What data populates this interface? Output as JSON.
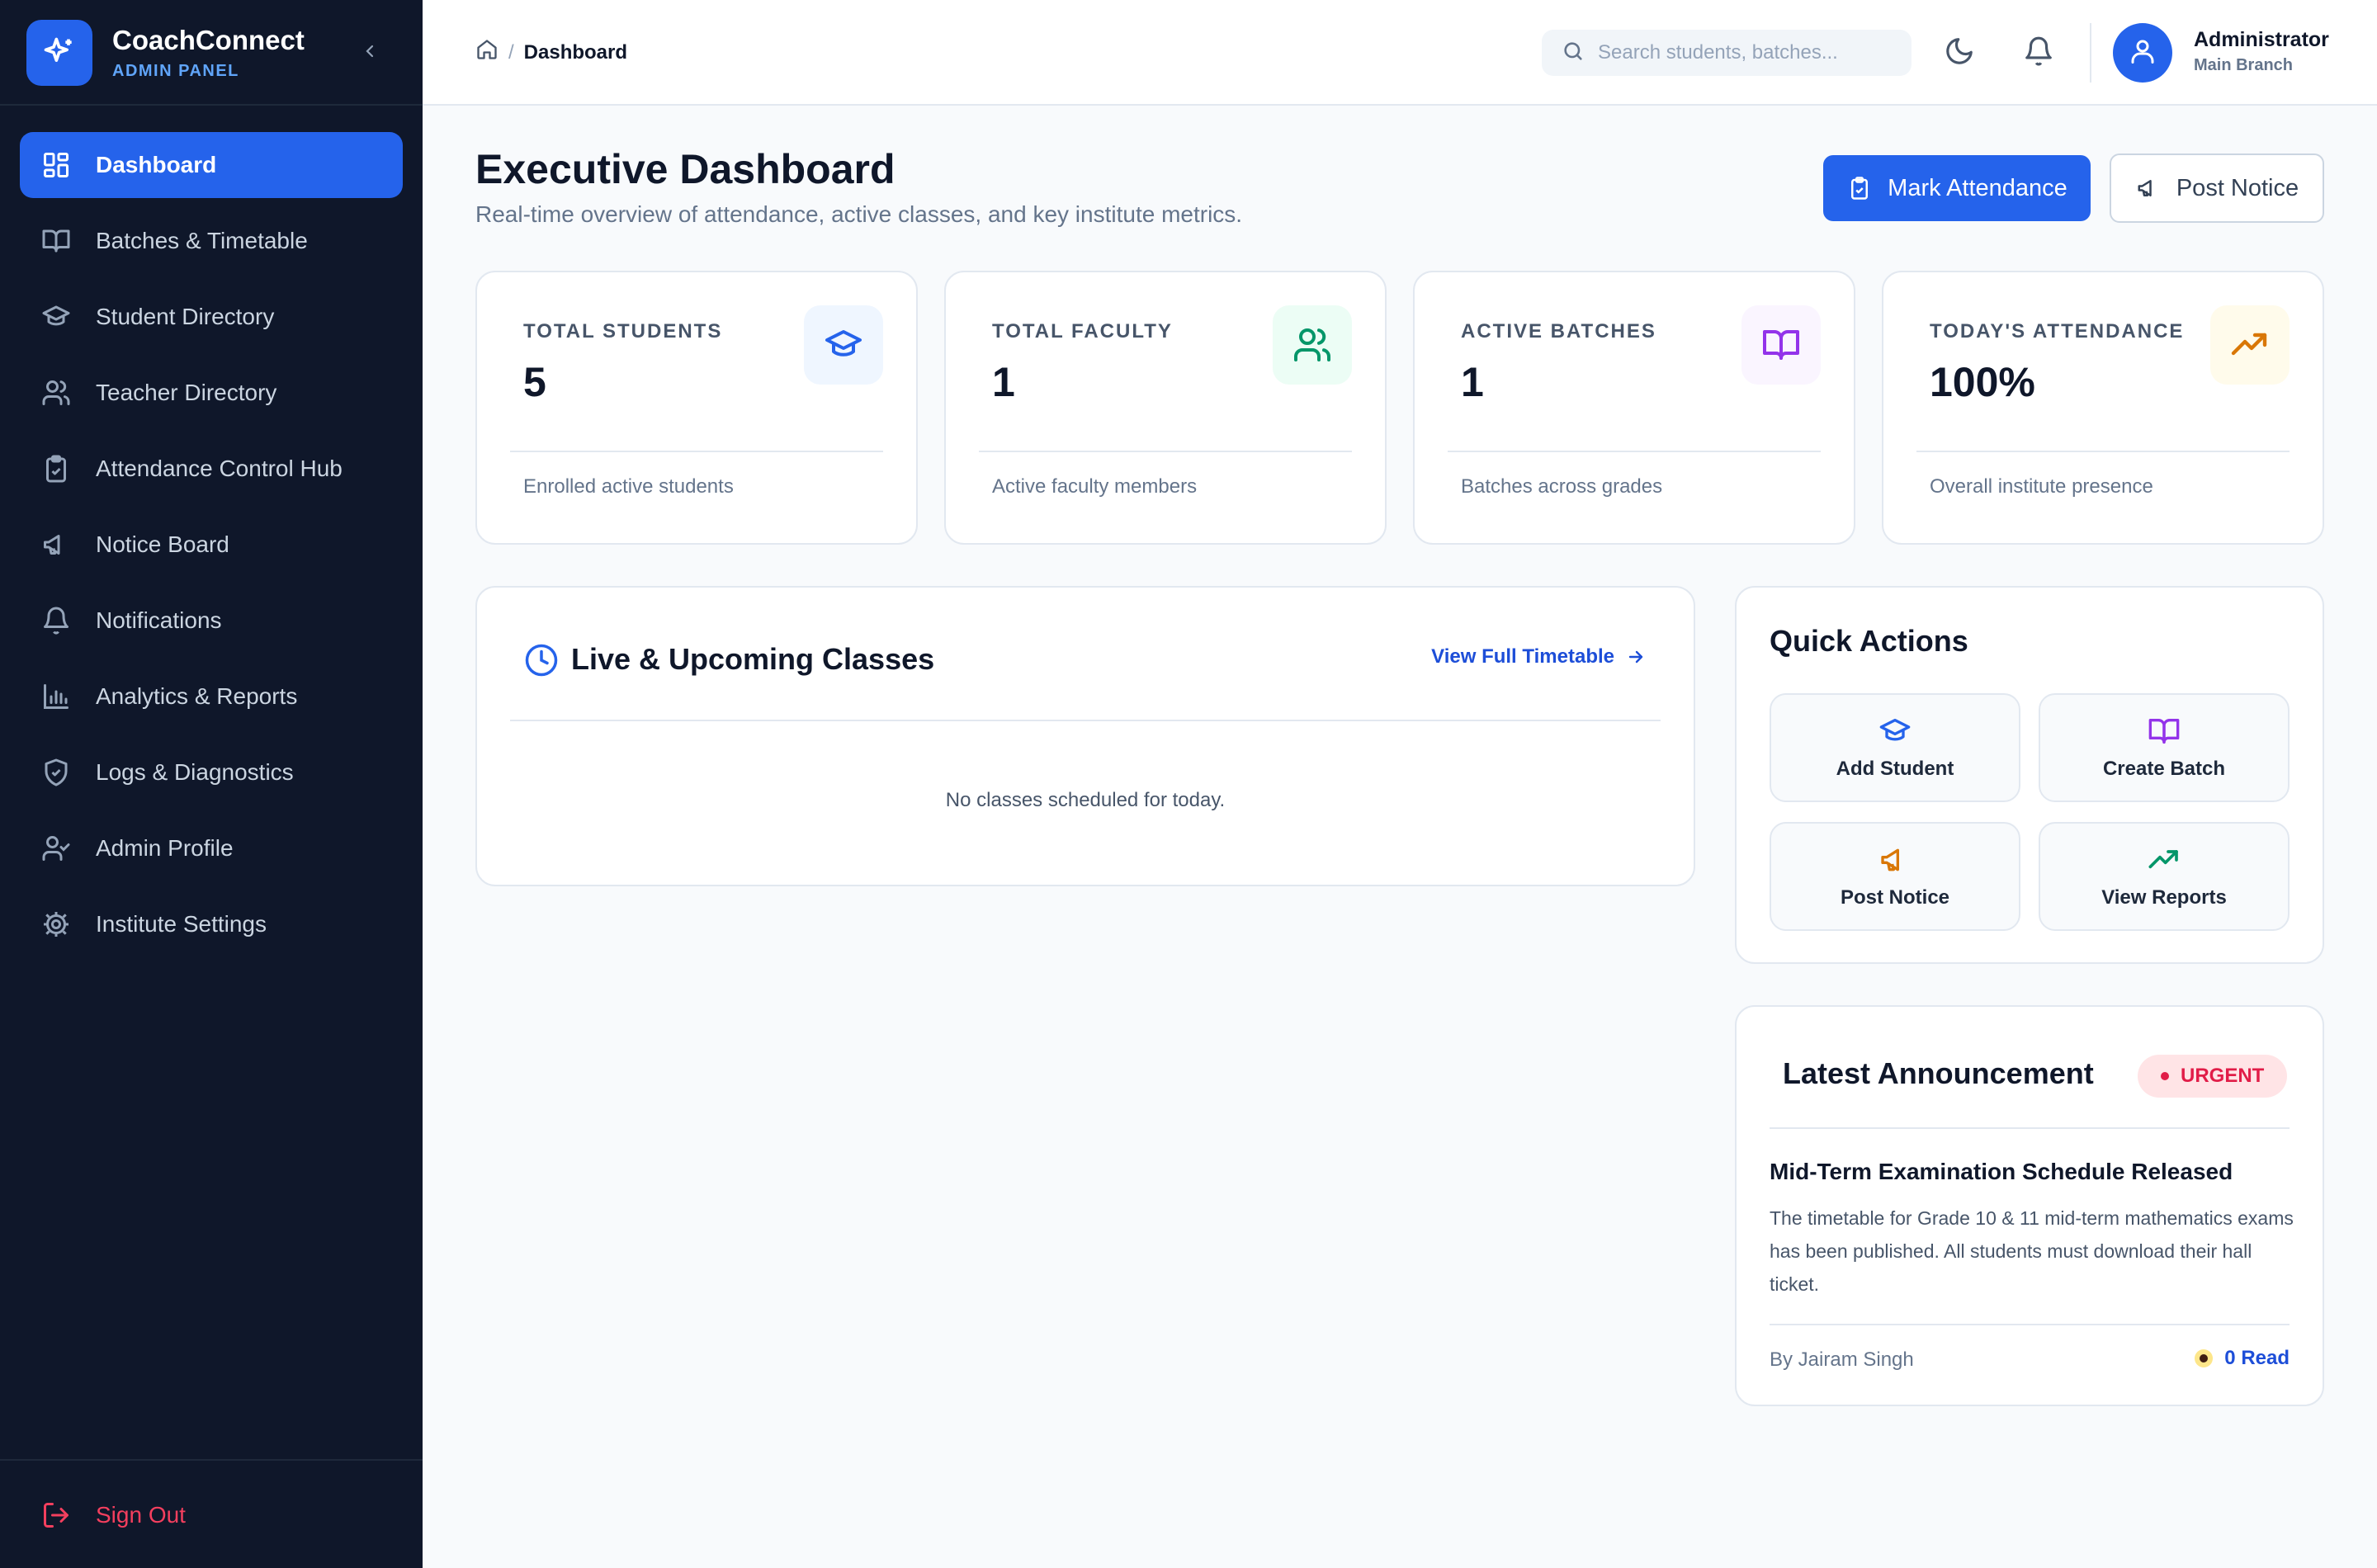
{
  "brand": {
    "name": "CoachConnect",
    "subtitle": "ADMIN PANEL"
  },
  "sidebar": {
    "items": [
      {
        "label": "Dashboard",
        "icon": "grid-icon",
        "active": true
      },
      {
        "label": "Batches & Timetable",
        "icon": "book-open-icon"
      },
      {
        "label": "Student Directory",
        "icon": "graduation-cap-icon"
      },
      {
        "label": "Teacher Directory",
        "icon": "users-icon"
      },
      {
        "label": "Attendance Control Hub",
        "icon": "clipboard-check-icon"
      },
      {
        "label": "Notice Board",
        "icon": "megaphone-icon"
      },
      {
        "label": "Notifications",
        "icon": "bell-icon"
      },
      {
        "label": "Analytics & Reports",
        "icon": "bar-chart-icon"
      },
      {
        "label": "Logs & Diagnostics",
        "icon": "shield-check-icon"
      },
      {
        "label": "Admin Profile",
        "icon": "user-check-icon"
      },
      {
        "label": "Institute Settings",
        "icon": "gear-icon"
      }
    ],
    "signout": "Sign Out"
  },
  "header": {
    "breadcrumb": {
      "current": "Dashboard",
      "separator": "/"
    },
    "search": {
      "placeholder": "Search students, batches..."
    },
    "user": {
      "name": "Administrator",
      "branch": "Main Branch"
    }
  },
  "main": {
    "title": "Executive Dashboard",
    "subtitle": "Real-time overview of attendance, active classes, and key institute metrics.",
    "actions": {
      "mark_attendance": "Mark Attendance",
      "post_notice": "Post Notice"
    },
    "stats": [
      {
        "label": "TOTAL STUDENTS",
        "value": "5",
        "foot": "Enrolled active students",
        "icon": "graduation-cap-icon",
        "color": "#2563eb",
        "bg": "#eff6ff"
      },
      {
        "label": "TOTAL FACULTY",
        "value": "1",
        "foot": "Active faculty members",
        "icon": "users-icon",
        "color": "#059669",
        "bg": "#ecfdf5"
      },
      {
        "label": "ACTIVE BATCHES",
        "value": "1",
        "foot": "Batches across grades",
        "icon": "book-open-icon",
        "color": "#9333ea",
        "bg": "#faf5ff"
      },
      {
        "label": "TODAY'S ATTENDANCE",
        "value": "100%",
        "foot": "Overall institute presence",
        "icon": "trending-up-icon",
        "color": "#d97706",
        "bg": "#fffbeb"
      }
    ],
    "classes": {
      "title": "Live & Upcoming Classes",
      "link": "View Full Timetable",
      "empty": "No classes scheduled for today."
    },
    "quick_actions": {
      "title": "Quick Actions",
      "items": [
        {
          "label": "Add Student",
          "icon": "graduation-cap-icon",
          "color": "#2563eb"
        },
        {
          "label": "Create Batch",
          "icon": "book-open-icon",
          "color": "#9333ea"
        },
        {
          "label": "Post Notice",
          "icon": "megaphone-icon",
          "color": "#d97706"
        },
        {
          "label": "View Reports",
          "icon": "trending-up-icon",
          "color": "#059669"
        }
      ]
    },
    "announcement": {
      "title": "Latest Announcement",
      "badge": "URGENT",
      "headline": "Mid-Term Examination Schedule Released",
      "body": "The timetable for Grade 10 & 11 mid-term mathematics exams has been published. All students must download their hall ticket.",
      "author": "By Jairam Singh",
      "read": "0 Read"
    }
  },
  "colors": {
    "accent": "#2563eb",
    "sidebar_bg": "#0f172a",
    "danger": "#e11d48"
  }
}
